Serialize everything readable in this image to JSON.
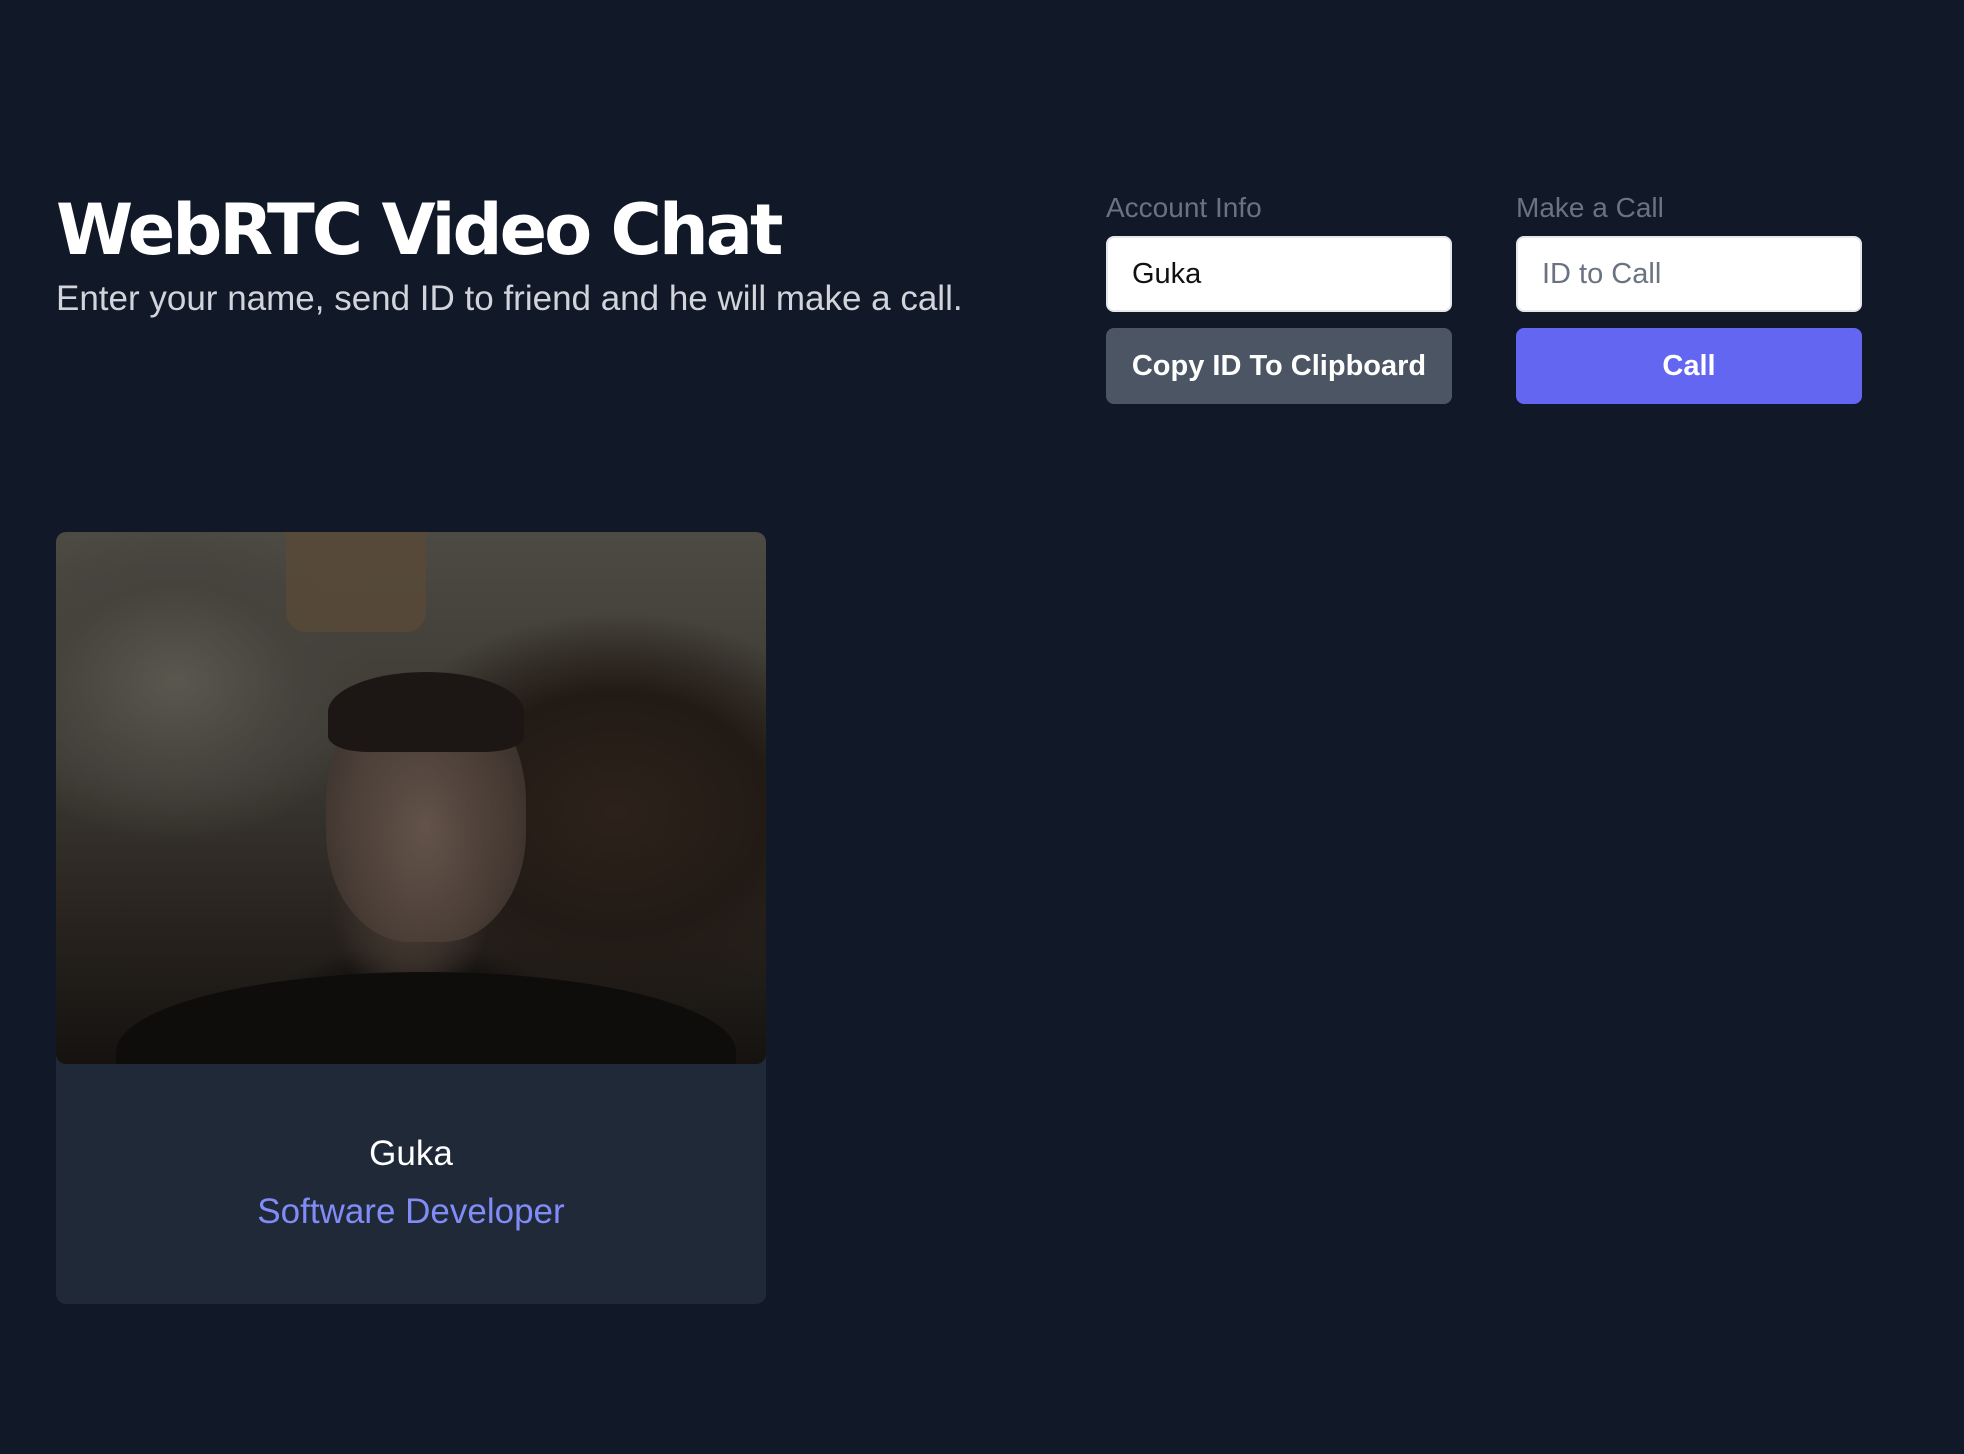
{
  "header": {
    "title": "WebRTC Video Chat",
    "subtitle": "Enter your name, send ID to friend and he will make a call."
  },
  "account": {
    "label": "Account Info",
    "name_value": "Guka",
    "copy_button_label": "Copy ID To Clipboard"
  },
  "call": {
    "label": "Make a Call",
    "id_placeholder": "ID to Call",
    "id_value": "",
    "call_button_label": "Call"
  },
  "video_card": {
    "name": "Guka",
    "role": "Software Developer"
  },
  "colors": {
    "background": "#111827",
    "card": "#1f2937",
    "accent": "#6366f1",
    "role_text": "#818cf8",
    "secondary_button": "#4b5563"
  }
}
